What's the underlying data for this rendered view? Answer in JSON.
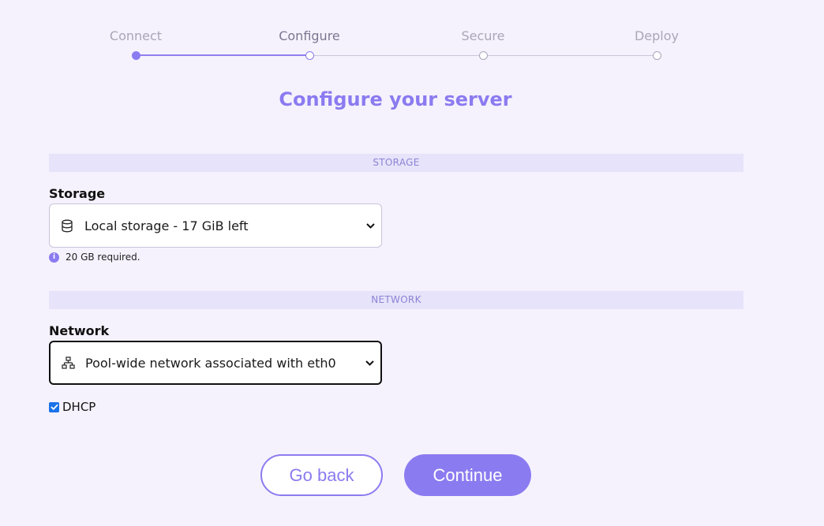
{
  "stepper": {
    "steps": [
      {
        "label": "Connect",
        "state": "done"
      },
      {
        "label": "Configure",
        "state": "current"
      },
      {
        "label": "Secure",
        "state": "pending"
      },
      {
        "label": "Deploy",
        "state": "pending"
      }
    ]
  },
  "title": "Configure your server",
  "storage_section": {
    "header": "STORAGE",
    "label": "Storage",
    "selected": "Local storage - 17 GiB left",
    "icon": "database-icon",
    "hint": "20 GB required."
  },
  "network_section": {
    "header": "NETWORK",
    "label": "Network",
    "selected": "Pool-wide network associated with eth0",
    "icon": "network-icon",
    "dhcp_label": "DHCP",
    "dhcp_checked": true
  },
  "actions": {
    "back_label": "Go back",
    "continue_label": "Continue"
  },
  "colors": {
    "accent": "#8b7bf0",
    "background": "#f5f2fd",
    "section_bar": "#e6e3fa"
  }
}
